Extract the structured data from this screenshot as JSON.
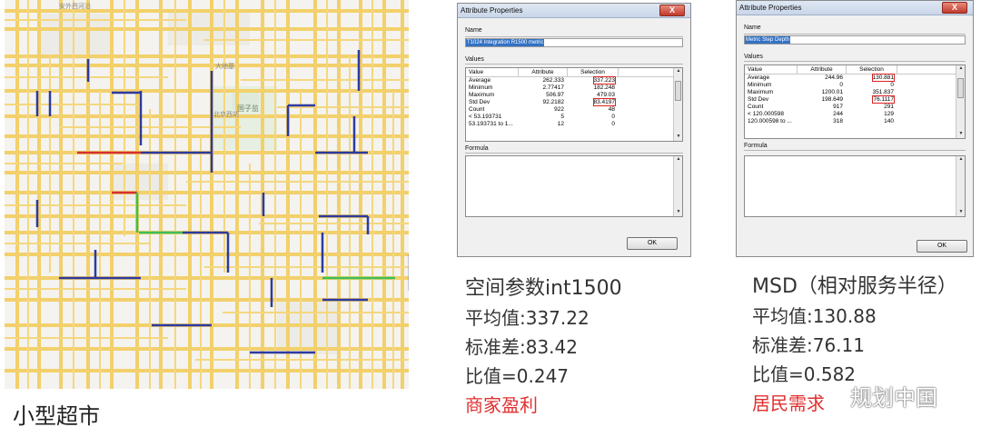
{
  "map": {
    "place_labels": [
      "安外西河沿",
      "大地基",
      "北京西站",
      "国子监"
    ],
    "caption": "小型超市"
  },
  "dialogs": [
    {
      "title": "Attribute Properties",
      "close_label": "X",
      "name_label": "Name",
      "name_value": "T1024 Integration R1500 metric",
      "values_label": "Values",
      "columns": [
        "Value",
        "Attribute",
        "Selection"
      ],
      "rows": [
        {
          "value": "Average",
          "attribute": "262.333",
          "selection": "337.223",
          "highlight": true
        },
        {
          "value": "Minimum",
          "attribute": "2.77417",
          "selection": "182.248",
          "highlight": false
        },
        {
          "value": "Maximum",
          "attribute": "506.97",
          "selection": "479.03",
          "highlight": false
        },
        {
          "value": "Std Dev",
          "attribute": "92.2182",
          "selection": "83.4197",
          "highlight": true
        },
        {
          "value": "Count",
          "attribute": "922",
          "selection": "48",
          "highlight": false
        },
        {
          "value": "< 53.193731",
          "attribute": "5",
          "selection": "0",
          "highlight": false
        },
        {
          "value": "53.193731 to 1...",
          "attribute": "12",
          "selection": "0",
          "highlight": false
        }
      ],
      "formula_label": "Formula",
      "ok_label": "OK"
    },
    {
      "title": "Attribute Properties",
      "close_label": "X",
      "name_label": "Name",
      "name_value": "Metric Step Depth",
      "values_label": "Values",
      "columns": [
        "Value",
        "Attribute",
        "Selection"
      ],
      "rows": [
        {
          "value": "Average",
          "attribute": "244.96",
          "selection": "130.881",
          "highlight": true
        },
        {
          "value": "Minimum",
          "attribute": "0",
          "selection": "0",
          "highlight": false
        },
        {
          "value": "Maximum",
          "attribute": "1200.01",
          "selection": "351.837",
          "highlight": false
        },
        {
          "value": "Std Dev",
          "attribute": "198.649",
          "selection": "76.1117",
          "highlight": true
        },
        {
          "value": "Count",
          "attribute": "917",
          "selection": "291",
          "highlight": false
        },
        {
          "value": "< 120.000598",
          "attribute": "244",
          "selection": "129",
          "highlight": false
        },
        {
          "value": "120.000598 to ...",
          "attribute": "318",
          "selection": "140",
          "highlight": false
        }
      ],
      "formula_label": "Formula",
      "ok_label": "OK"
    }
  ],
  "panels": [
    {
      "heading": "空间参数int1500",
      "line1": "平均值:337.22",
      "line2": "标准差:83.42",
      "line3": "比值=0.247",
      "tag": "商家盈利"
    },
    {
      "heading": "MSD（相对服务半径）",
      "line1": "平均值:130.88",
      "line2": "标准差:76.11",
      "line3": "比值=0.582",
      "tag": "居民需求"
    }
  ],
  "watermark": "规划中国",
  "colors": {
    "road": "#f2d06b",
    "blue_segment": "#2d3aa0",
    "red_segment": "#d63030",
    "green_segment": "#3cbf5a",
    "highlight_box": "#dd2222",
    "tag_red": "#e03030"
  }
}
